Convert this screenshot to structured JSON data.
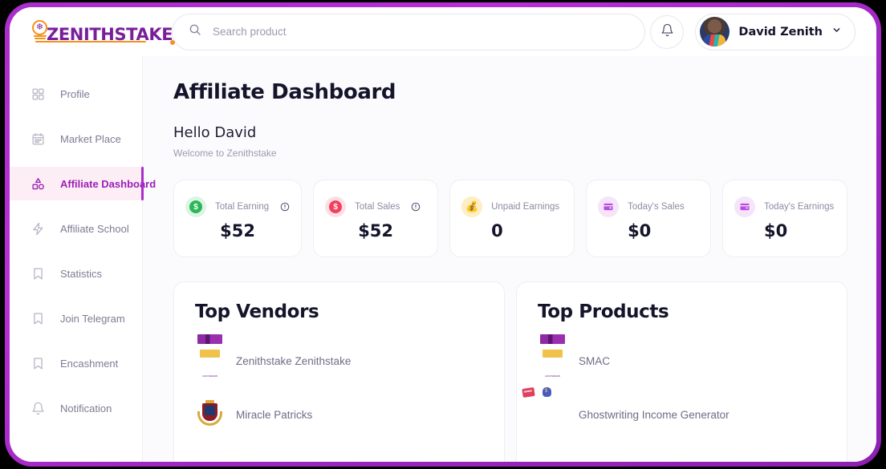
{
  "brand": {
    "logo_text": "ZENITHSTAKE",
    "logo_icon": "lightbulb-snowflake-icon"
  },
  "search": {
    "placeholder": "Search product",
    "value": "",
    "icon": "search-icon"
  },
  "header": {
    "notification_icon": "bell-icon",
    "user_name": "David Zenith",
    "chevron_icon": "chevron-down-icon",
    "avatar_icon": "user-avatar"
  },
  "sidebar": {
    "items": [
      {
        "label": "Profile",
        "icon": "grid-icon",
        "active": false
      },
      {
        "label": "Market Place",
        "icon": "calendar-icon",
        "active": false
      },
      {
        "label": "Affiliate Dashboard",
        "icon": "shapes-icon",
        "active": true
      },
      {
        "label": "Affiliate School",
        "icon": "lightning-icon",
        "active": false
      },
      {
        "label": "Statistics",
        "icon": "bookmark-icon",
        "active": false
      },
      {
        "label": "Join Telegram",
        "icon": "bookmark-icon",
        "active": false
      },
      {
        "label": "Encashment",
        "icon": "bookmark-icon",
        "active": false
      },
      {
        "label": "Notification",
        "icon": "bell-icon",
        "active": false
      }
    ]
  },
  "main": {
    "page_title": "Affiliate Dashboard",
    "greeting": "Hello David",
    "subgreeting": "Welcome to Zenithstake",
    "stats": [
      {
        "label": "Total Earning",
        "value": "$52",
        "icon": "dollar-coin-green-icon",
        "has_info": true
      },
      {
        "label": "Total Sales",
        "value": "$52",
        "icon": "dollar-coin-red-icon",
        "has_info": true
      },
      {
        "label": "Unpaid Earnings",
        "value": "0",
        "icon": "money-bag-icon",
        "has_info": false
      },
      {
        "label": "Today's Sales",
        "value": "$0",
        "icon": "wallet-icon",
        "has_info": false
      },
      {
        "label": "Today's Earnings",
        "value": "$0",
        "icon": "wallet-icon",
        "has_info": false
      }
    ],
    "panels": [
      {
        "title": "Top Vendors",
        "entries": [
          {
            "label": "Zenithstake Zenithstake",
            "thumb": "product-box-thumbnail"
          },
          {
            "label": "Miracle Patricks",
            "thumb": "crest-badge-thumbnail"
          }
        ]
      },
      {
        "title": "Top Products",
        "entries": [
          {
            "label": "SMAC",
            "thumb": "product-box-thumbnail"
          },
          {
            "label": "Ghostwriting Income Generator",
            "thumb": "ghostwriting-circle-thumbnail"
          }
        ]
      }
    ]
  },
  "colors": {
    "frame": "#a82ec9",
    "brand_purple": "#7a1f9c",
    "brand_orange": "#f5921e",
    "active_nav_bg": "#fdeef6",
    "active_nav_text": "#9b1fb5",
    "page_bg": "#fbfbfd"
  }
}
